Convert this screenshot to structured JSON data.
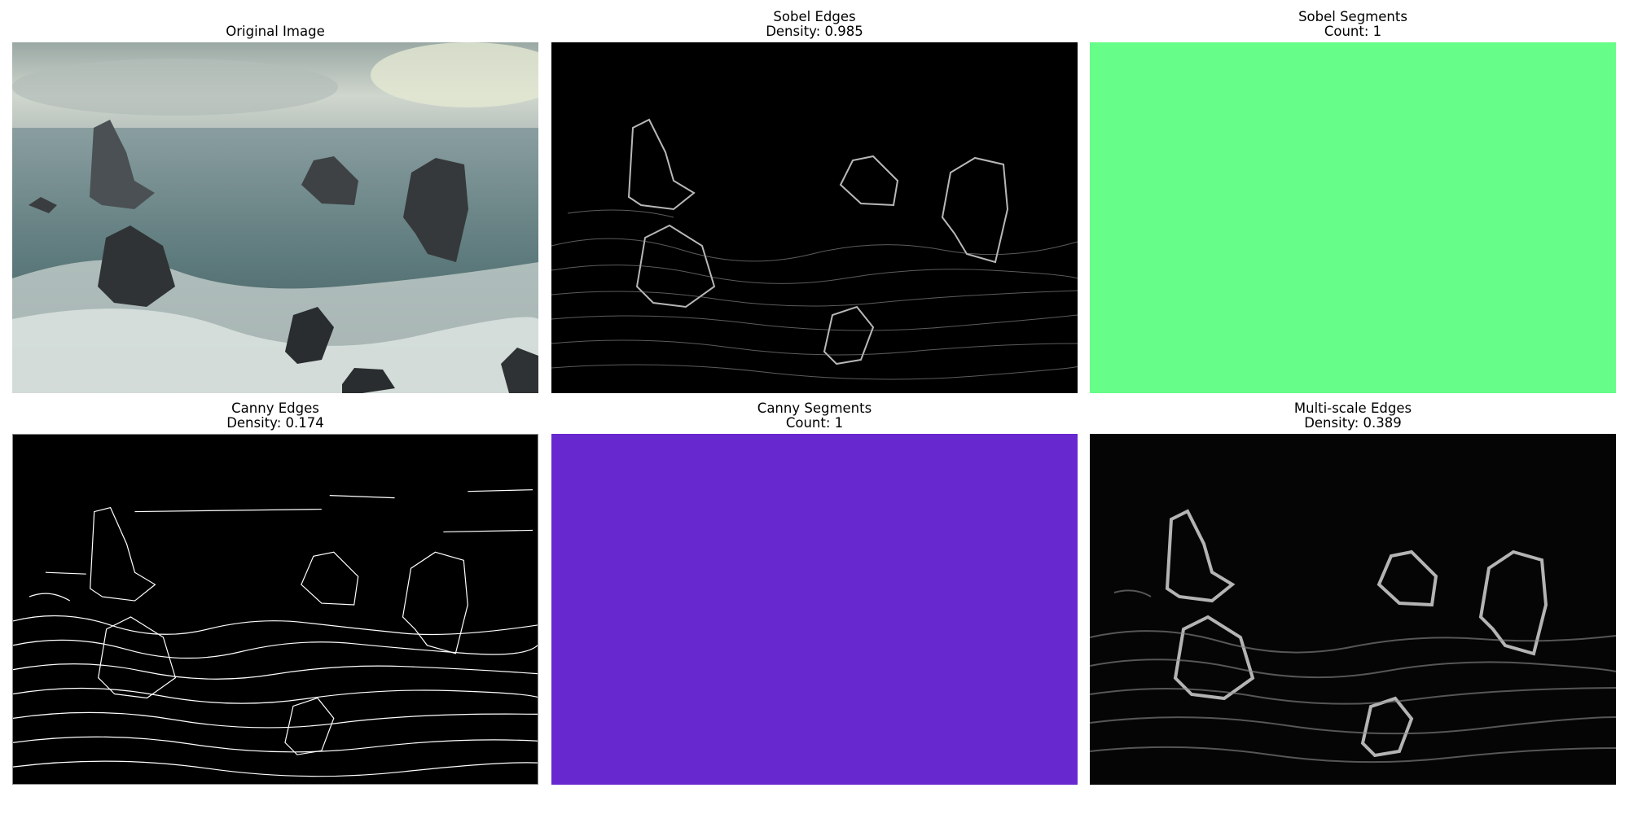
{
  "panels": [
    {
      "id": "original",
      "title": "Original Image",
      "subtitle": "",
      "image_kind": "photo",
      "description_icon": "seascape-photo"
    },
    {
      "id": "sobel-edges",
      "title": "Sobel Edges",
      "subtitle": "Density: 0.985",
      "image_kind": "edge-map"
    },
    {
      "id": "sobel-segments",
      "title": "Sobel Segments",
      "subtitle": "Count: 1",
      "image_kind": "solid",
      "fill_color": "#66fd88"
    },
    {
      "id": "canny-edges",
      "title": "Canny Edges",
      "subtitle": "Density: 0.174",
      "image_kind": "edge-map"
    },
    {
      "id": "canny-segments",
      "title": "Canny Segments",
      "subtitle": "Count: 1",
      "image_kind": "solid",
      "fill_color": "#6828cf"
    },
    {
      "id": "multiscale-edges",
      "title": "Multi-scale Edges",
      "subtitle": "Density: 0.389",
      "image_kind": "edge-map"
    }
  ],
  "colors": {
    "background": "#ffffff",
    "title_text": "#000000",
    "edge_background": "#000000",
    "edge_stroke": "#ffffff",
    "sea": "#5d7a7c",
    "sky": "#c9d2cc",
    "rock": "#3e4245",
    "foam": "#e6ece8"
  }
}
